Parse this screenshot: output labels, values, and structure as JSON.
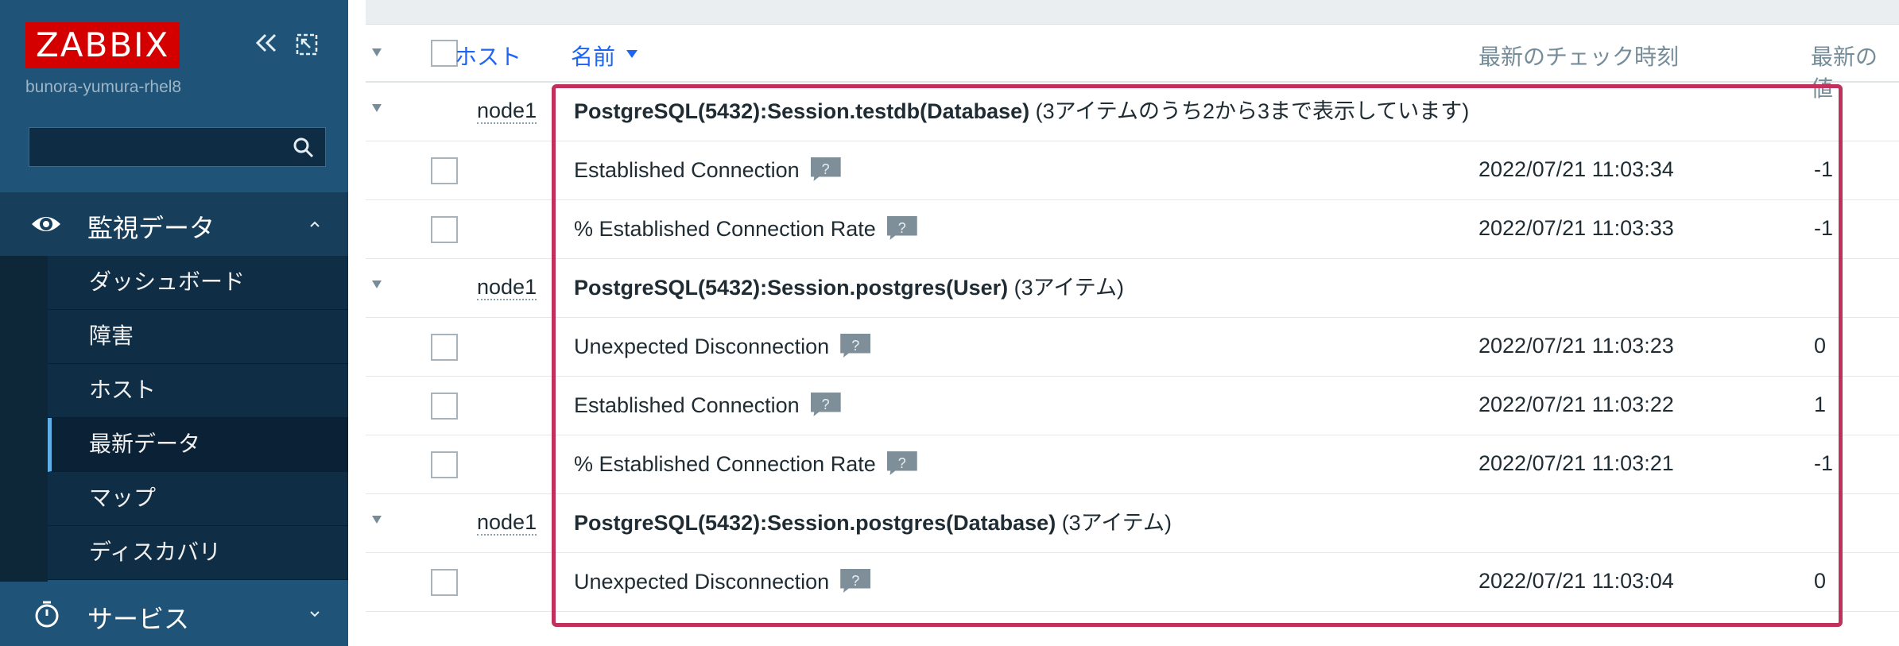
{
  "sidebar": {
    "logo": "ZABBIX",
    "server_name": "bunora-yumura-rhel8",
    "search_value": "",
    "monitoring": {
      "label": "監視データ",
      "items": [
        {
          "label": "ダッシュボード"
        },
        {
          "label": "障害"
        },
        {
          "label": "ホスト"
        },
        {
          "label": "最新データ"
        },
        {
          "label": "マップ"
        },
        {
          "label": "ディスカバリ"
        }
      ],
      "selected_index": 3
    },
    "service": {
      "label": "サービス"
    }
  },
  "table": {
    "headers": {
      "host": "ホスト",
      "name": "名前",
      "last_check": "最新のチェック時刻",
      "last_value": "最新の値"
    },
    "rows": [
      {
        "type": "group",
        "host": "node1",
        "name_bold": "PostgreSQL(5432):Session.testdb(Database)",
        "name_suffix": " (3アイテムのうち2から3まで表示しています)"
      },
      {
        "type": "item",
        "name": "Established Connection",
        "time": "2022/07/21 11:03:34",
        "value": "-1"
      },
      {
        "type": "item",
        "name": "% Established Connection Rate",
        "time": "2022/07/21 11:03:33",
        "value": "-1"
      },
      {
        "type": "group",
        "host": "node1",
        "name_bold": "PostgreSQL(5432):Session.postgres(User)",
        "name_suffix": " (3アイテム)"
      },
      {
        "type": "item",
        "name": "Unexpected Disconnection",
        "time": "2022/07/21 11:03:23",
        "value": "0"
      },
      {
        "type": "item",
        "name": "Established Connection",
        "time": "2022/07/21 11:03:22",
        "value": "1"
      },
      {
        "type": "item",
        "name": "% Established Connection Rate",
        "time": "2022/07/21 11:03:21",
        "value": "-1"
      },
      {
        "type": "group",
        "host": "node1",
        "name_bold": "PostgreSQL(5432):Session.postgres(Database)",
        "name_suffix": " (3アイテム)"
      },
      {
        "type": "item",
        "name": "Unexpected Disconnection",
        "time": "2022/07/21 11:03:04",
        "value": "0"
      }
    ],
    "help_icon_glyph": "?"
  },
  "colors": {
    "sidebar_bg": "#1f5377",
    "logo_bg": "#d40000",
    "link_blue": "#1f65f4",
    "highlight_border": "#c0325d"
  }
}
